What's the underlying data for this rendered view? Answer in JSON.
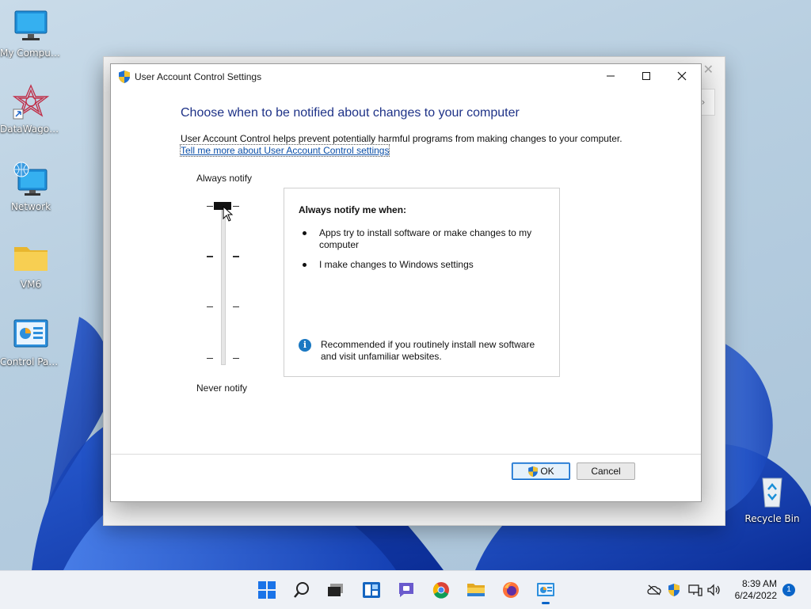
{
  "desktop": {
    "icons": [
      {
        "label": "My Computer",
        "icon": "monitor-icon"
      },
      {
        "label": "DataWagon...",
        "icon": "datawagon-shortcut-icon"
      },
      {
        "label": "Network",
        "icon": "network-globe-icon"
      },
      {
        "label": "VM6",
        "icon": "folder-icon"
      },
      {
        "label": "Control Panel",
        "icon": "control-panel-icon"
      },
      {
        "label": "Recycle Bin",
        "icon": "recycle-bin-icon"
      }
    ]
  },
  "dialog": {
    "title": "User Account Control Settings",
    "heading": "Choose when to be notified about changes to your computer",
    "description": "User Account Control helps prevent potentially harmful programs from making changes to your computer.",
    "link": "Tell me more about User Account Control settings",
    "slider": {
      "top_label": "Always notify",
      "bottom_label": "Never notify",
      "levels": 4,
      "selected_level_from_bottom": 4
    },
    "info": {
      "heading": "Always notify me when:",
      "bullets": [
        "Apps try to install software or make changes to my computer",
        "I make changes to Windows settings"
      ],
      "recommendation": "Recommended if you routinely install new software and visit unfamiliar websites."
    },
    "ok_label": "OK",
    "cancel_label": "Cancel"
  },
  "taskbar": {
    "apps": [
      "start-icon",
      "search-icon",
      "task-view-icon",
      "widgets-icon",
      "chat-icon",
      "chrome-icon",
      "file-explorer-icon",
      "firefox-icon",
      "control-panel-icon"
    ],
    "time": "8:39 AM",
    "date": "6/24/2022",
    "notification_count": "1"
  },
  "colors": {
    "heading": "#1e3287",
    "link": "#0b4fa8",
    "accent": "#0a64c8"
  }
}
